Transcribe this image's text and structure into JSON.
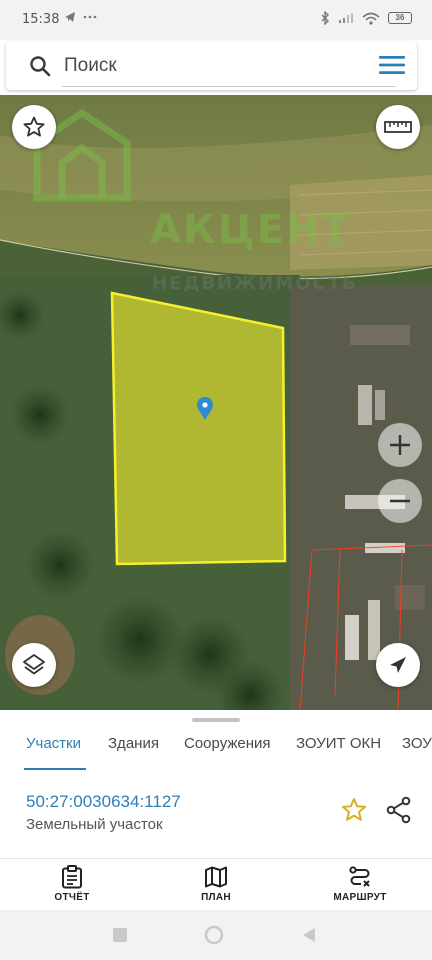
{
  "status_bar": {
    "time": "15:38",
    "battery": "36",
    "icons": [
      "telegram-icon",
      "more-icon",
      "bluetooth-icon",
      "signal-icon",
      "wifi-icon",
      "battery-icon"
    ]
  },
  "search": {
    "placeholder": "Поиск"
  },
  "map": {
    "watermark_title": "АКЦЕНТ",
    "watermark_subtitle": "НЕДВИЖИМОСТЬ",
    "highlight_color": "#f2ee2a",
    "boundary_color": "#ff3b1f"
  },
  "tabs": [
    {
      "label": "Участки",
      "active": true
    },
    {
      "label": "Здания",
      "active": false
    },
    {
      "label": "Сооружения",
      "active": false
    },
    {
      "label": "ЗОУИТ ОКН",
      "active": false
    },
    {
      "label": "ЗОУ",
      "active": false
    }
  ],
  "parcel": {
    "number": "50:27:0030634:1127",
    "type": "Земельный участок"
  },
  "bottom_nav": {
    "report": "ОТЧЁТ",
    "plan": "ПЛАН",
    "route": "МАРШРУТ"
  },
  "colors": {
    "accent": "#2f7fb7",
    "favorite": "#d9b021"
  }
}
